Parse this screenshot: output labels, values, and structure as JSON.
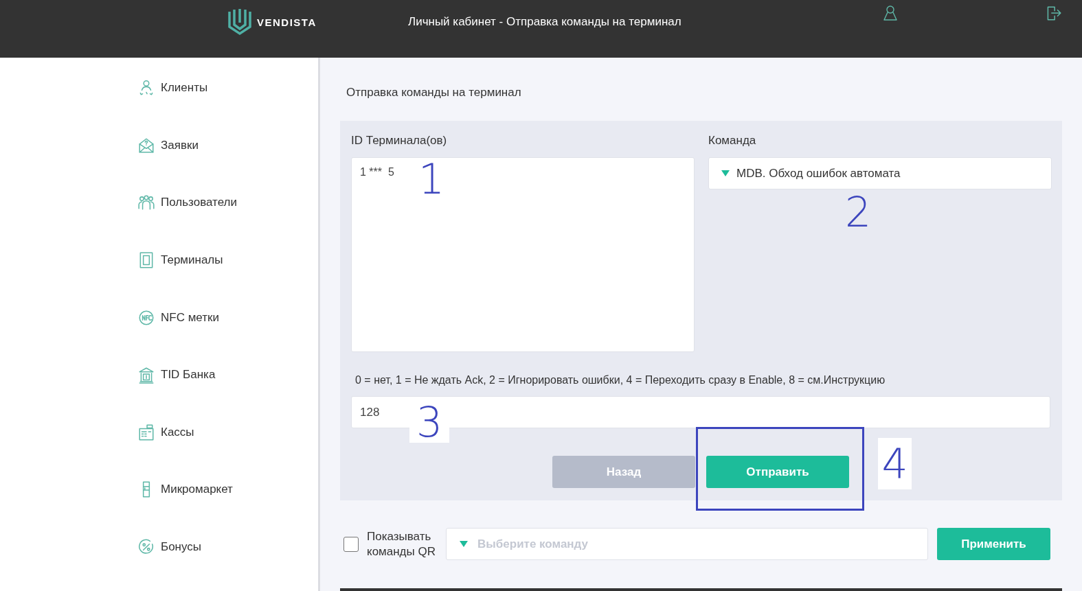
{
  "header": {
    "logo": "VENDISTA",
    "title": "Личный кабинет - Отправка команды на терминал"
  },
  "sidebar": {
    "items": [
      {
        "label": "Клиенты",
        "kind": "clients"
      },
      {
        "label": "Заявки",
        "kind": "requests"
      },
      {
        "label": "Пользователи",
        "kind": "users"
      },
      {
        "label": "Терминалы",
        "kind": "terminals"
      },
      {
        "label": "NFC метки",
        "kind": "nfc"
      },
      {
        "label": "TID Банка",
        "kind": "bank"
      },
      {
        "label": "Кассы",
        "kind": "cashbox"
      },
      {
        "label": "Микромаркет",
        "kind": "micromarket"
      },
      {
        "label": "Бонусы",
        "kind": "bonus"
      }
    ]
  },
  "page_title": "Отправка команды на терминал",
  "form": {
    "terminal_ids": {
      "label": "ID Терминала(ов)",
      "value": "1 ***  5"
    },
    "command": {
      "label": "Команда",
      "value": "MDB. Обход ошибок автомата"
    },
    "parameter": {
      "hint": "0 = нет, 1 = Не ждать Ack, 2 = Игнорировать ошибки, 4 = Переходить сразу в Enable, 8 = см.Инструкцию",
      "value": "128"
    },
    "buttons": [
      {
        "label": "Назад",
        "kind": "secondary"
      },
      {
        "label": "Отправить",
        "kind": "primary"
      }
    ]
  },
  "qr": {
    "checkbox": {
      "label": "Показывать команды QR",
      "checked": false
    },
    "select": {
      "placeholder": "Выберите команду"
    },
    "button": "Применить"
  },
  "annotations": [
    {
      "label": "1"
    },
    {
      "label": "2"
    },
    {
      "label": "3"
    },
    {
      "label": "4"
    }
  ]
}
